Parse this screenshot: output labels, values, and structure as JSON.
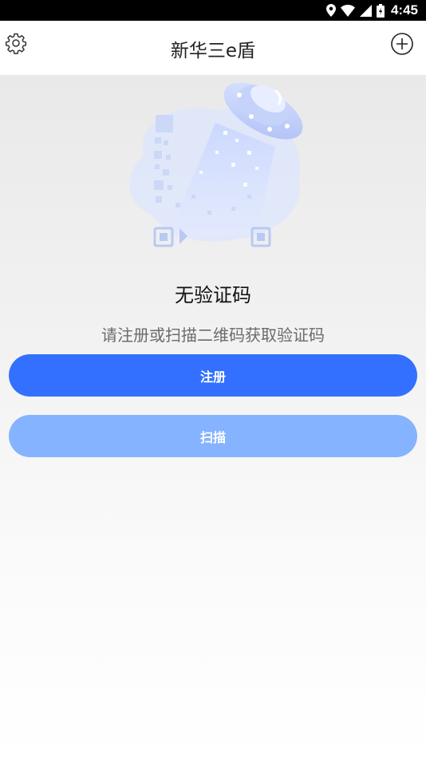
{
  "status_bar": {
    "time": "4:45",
    "icons": [
      "location-icon",
      "wifi-icon",
      "signal-icon",
      "battery-icon"
    ]
  },
  "app_bar": {
    "title": "新华三e盾",
    "left_icon": "gear-icon",
    "right_icon": "add-circle-icon"
  },
  "empty_state": {
    "illustration": "ufo-scanning-qr-illustration",
    "title": "无验证码",
    "subtitle": "请注册或扫描二维码获取验证码"
  },
  "actions": {
    "register_label": "注册",
    "scan_label": "扫描"
  },
  "colors": {
    "primary": "#3370ff",
    "primary_light": "#86b3ff",
    "background": "#efefef"
  }
}
